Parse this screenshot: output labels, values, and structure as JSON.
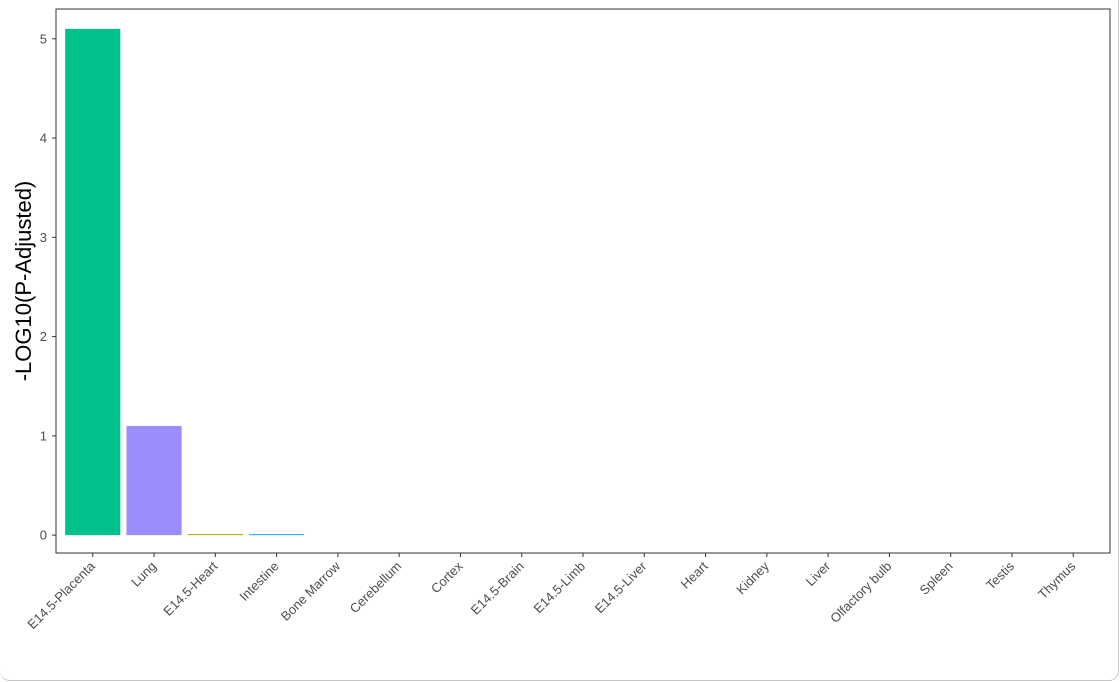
{
  "chart_data": {
    "type": "bar",
    "title": "",
    "xlabel": "",
    "ylabel": "-LOG10(P-Adjusted)",
    "ylim": [
      -0.18,
      5.3
    ],
    "yticks": [
      0,
      1,
      2,
      3,
      4,
      5
    ],
    "grid": false,
    "legend": "none",
    "categories": [
      "E14.5-Placenta",
      "Lung",
      "E14.5-Heart",
      "Intestine",
      "Bone Marrow",
      "Cerebellum",
      "Cortex",
      "E14.5-Brain",
      "E14.5-Limb",
      "E14.5-Liver",
      "Heart",
      "Kidney",
      "Liver",
      "Olfactory bulb",
      "Spleen",
      "Testis",
      "Thymus"
    ],
    "values": [
      5.1,
      1.1,
      0.01,
      0.01,
      0,
      0,
      0,
      0,
      0,
      0,
      0,
      0,
      0,
      0,
      0,
      0,
      0
    ],
    "colors": [
      "#00c08b",
      "#9c8dff",
      "#a3a500",
      "#00b0f6",
      "#e76bf3",
      "#e76bf3",
      "#e76bf3",
      "#e76bf3",
      "#e76bf3",
      "#e76bf3",
      "#e76bf3",
      "#e76bf3",
      "#e76bf3",
      "#e76bf3",
      "#e76bf3",
      "#e76bf3",
      "#e76bf3"
    ]
  }
}
